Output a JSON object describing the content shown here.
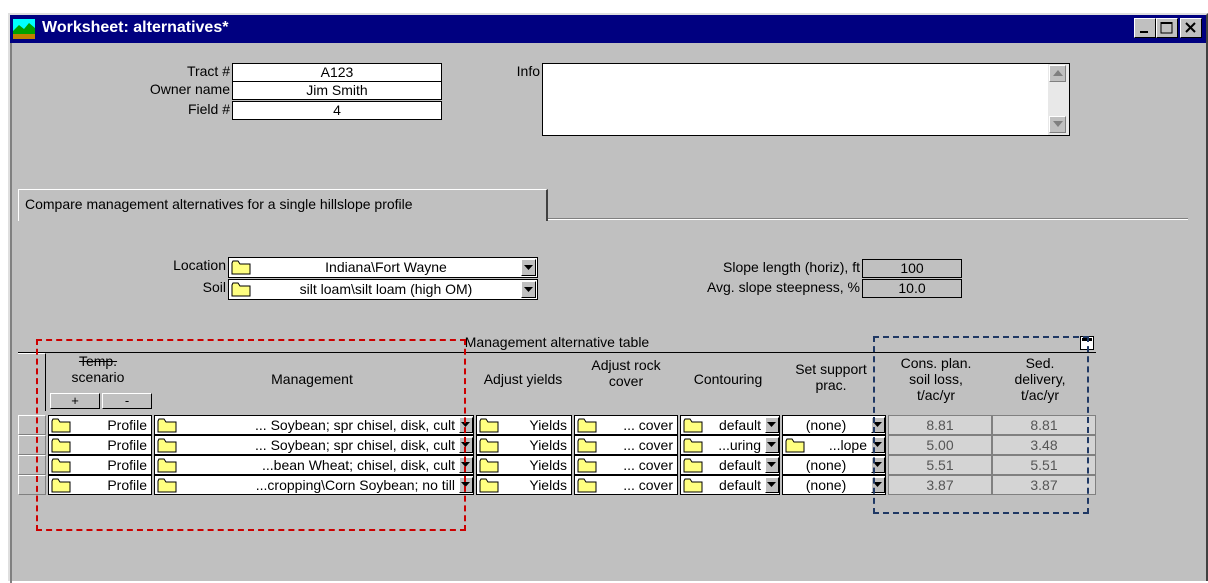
{
  "window": {
    "title": "Worksheet:  alternatives*"
  },
  "header": {
    "tract_label": "Tract #",
    "tract_value": "A123",
    "owner_label": "Owner name",
    "owner_value": "Jim Smith",
    "field_label": "Field #",
    "field_value": "4",
    "info_label": "Info",
    "info_value": ""
  },
  "tab": {
    "label": "Compare management alternatives for a single hillslope profile"
  },
  "site": {
    "location_label": "Location",
    "location_value": "Indiana\\Fort Wayne",
    "soil_label": "Soil",
    "soil_value": "silt loam\\silt loam (high OM)",
    "slope_length_label": "Slope length (horiz), ft",
    "slope_length_value": "100",
    "slope_steep_label": "Avg. slope steepness, %",
    "slope_steep_value": "10.0"
  },
  "table": {
    "title": "Management alternative table",
    "headers": {
      "temp_scenario": [
        "Temp.",
        "scenario"
      ],
      "management": "Management",
      "adjust_yields": "Adjust yields",
      "adjust_rock": [
        "Adjust rock",
        "cover"
      ],
      "contouring": "Contouring",
      "support": [
        "Set support",
        "prac."
      ],
      "soil_loss": [
        "Cons. plan.",
        "soil loss,",
        "t/ac/yr"
      ],
      "sed_delivery": [
        "Sed.",
        "delivery,",
        "t/ac/yr"
      ]
    },
    "plus_label": "+",
    "minus_label": "-",
    "rows": [
      {
        "profile": "Profile",
        "management": "... Soybean; spr chisel, disk, cult",
        "yields": "Yields",
        "rock": "... cover",
        "contour": "default",
        "support": "(none)",
        "soil_loss": "8.81",
        "sed": "8.81"
      },
      {
        "profile": "Profile",
        "management": "... Soybean; spr chisel, disk, cult",
        "yields": "Yields",
        "rock": "... cover",
        "contour": "...uring",
        "support": "...lope",
        "soil_loss": "5.00",
        "sed": "3.48"
      },
      {
        "profile": "Profile",
        "management": "...bean Wheat; chisel, disk, cult",
        "yields": "Yields",
        "rock": "... cover",
        "contour": "default",
        "support": "(none)",
        "soil_loss": "5.51",
        "sed": "5.51"
      },
      {
        "profile": "Profile",
        "management": "...cropping\\Corn Soybean; no till",
        "yields": "Yields",
        "rock": "... cover",
        "contour": "default",
        "support": "(none)",
        "soil_loss": "3.87",
        "sed": "3.87"
      }
    ]
  },
  "colors": {
    "titlebar": "#000080",
    "red_highlight": "#cc0000",
    "blue_highlight": "#1f3864",
    "folder": "#ffff80"
  }
}
